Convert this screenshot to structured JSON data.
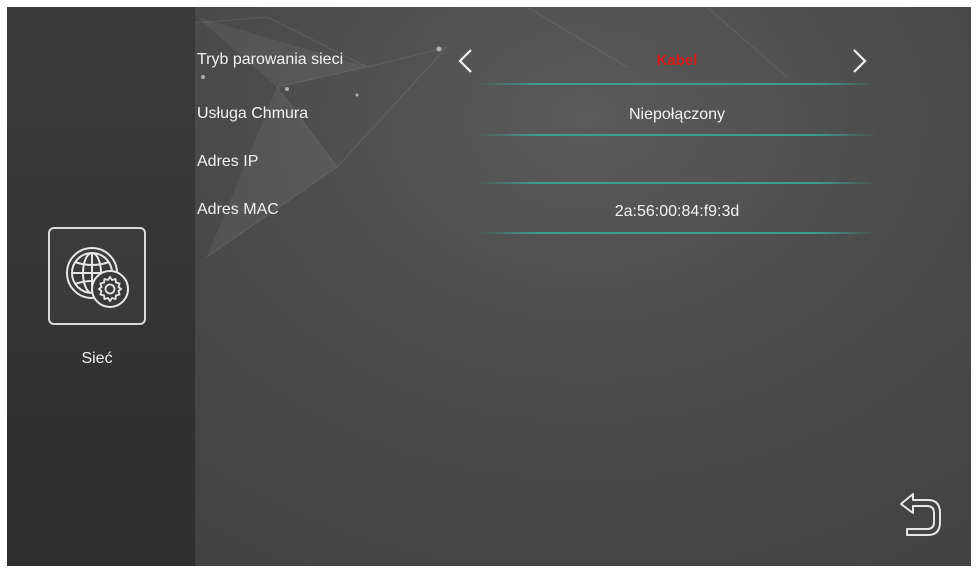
{
  "sidebar": {
    "items": [
      {
        "label": "Sieć",
        "icon": "network-settings-icon"
      }
    ]
  },
  "settings": {
    "rows": [
      {
        "label": "Tryb parowania sieci",
        "value": "Kabel",
        "value_color": "#d41b1b"
      },
      {
        "label": "Usługa Chmura",
        "value": "Niepołączony"
      },
      {
        "label": "Adres IP",
        "value": ""
      },
      {
        "label": "Adres MAC",
        "value": "2a:56:00:84:f9:3d"
      }
    ]
  },
  "icons": {
    "prev": "chevron-left-icon",
    "next": "chevron-right-icon",
    "back": "back-arrow-icon"
  },
  "colors": {
    "accent_line": "#3c9e8c",
    "selected_value": "#d41b1b"
  }
}
